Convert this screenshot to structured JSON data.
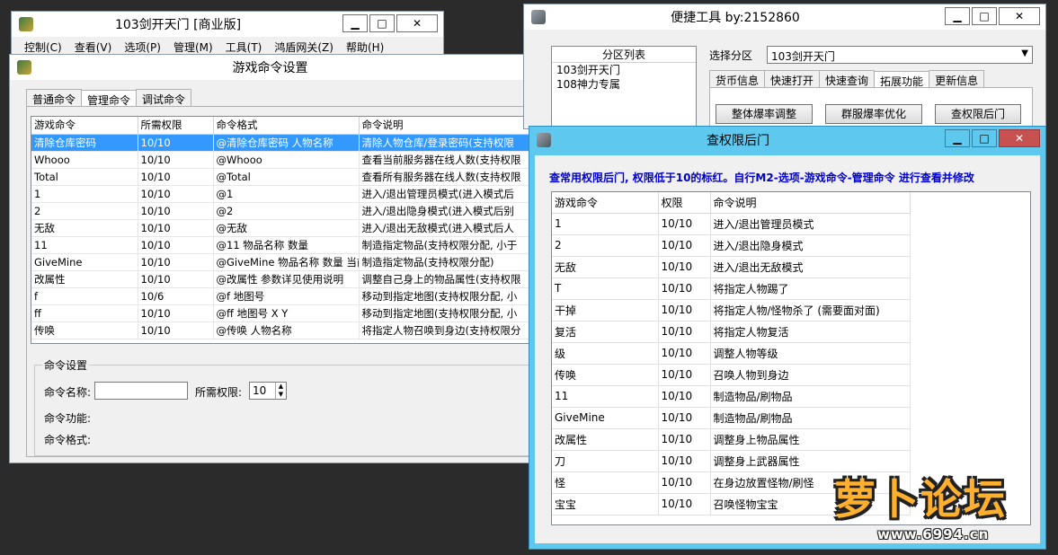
{
  "main_window": {
    "title": "103剑开天门 [商业版]",
    "menu": [
      "控制(C)",
      "查看(V)",
      "选项(P)",
      "管理(M)",
      "工具(T)",
      "鸿盾网关(Z)",
      "帮助(H)"
    ]
  },
  "cmd_window": {
    "title": "游戏命令设置",
    "tabs": [
      "普通命令",
      "管理命令",
      "调试命令"
    ],
    "columns": [
      "游戏命令",
      "所需权限",
      "命令格式",
      "命令说明"
    ],
    "rows": [
      [
        "清除仓库密码",
        "10/10",
        "@清除仓库密码 人物名称",
        "清除人物仓库/登录密码(支持权限"
      ],
      [
        "Whooo",
        "10/10",
        "@Whooo",
        "查看当前服务器在线人数(支持权限"
      ],
      [
        "Total",
        "10/10",
        "@Total",
        "查看所有服务器在线人数(支持权限"
      ],
      [
        "1",
        "10/10",
        "@1",
        "进入/退出管理员模式(进入模式后"
      ],
      [
        "2",
        "10/10",
        "@2",
        "进入/退出隐身模式(进入模式后别"
      ],
      [
        "无敌",
        "10/10",
        "@无敌",
        "进入/退出无敌模式(进入模式后人"
      ],
      [
        "11",
        "10/10",
        "@11 物品名称 数量",
        "制造指定物品(支持权限分配, 小于"
      ],
      [
        "GiveMine",
        "10/10",
        "@GiveMine 物品名称 数量 当前",
        "制造指定物品(支持权限分配)"
      ],
      [
        "改属性",
        "10/10",
        "@改属性 参数详见使用说明",
        "调整自己身上的物品属性(支持权限"
      ],
      [
        "f",
        "10/6",
        "@f 地图号",
        "移动到指定地图(支持权限分配, 小"
      ],
      [
        "ff",
        "10/10",
        "@ff 地图号 X Y",
        "移动到指定地图(支持权限分配, 小"
      ],
      [
        "传唤",
        "10/10",
        "@传唤 人物名称",
        "将指定人物召唤到身边(支持权限分"
      ]
    ],
    "settings": {
      "group_label": "命令设置",
      "name_label": "命令名称:",
      "name_value": "",
      "perm_label": "所需权限:",
      "perm_value": "10",
      "func_label": "命令功能:",
      "format_label": "命令格式:"
    }
  },
  "tool_window": {
    "title": "便捷工具 by:2152860",
    "list_header": "分区列表",
    "list_items": [
      "103剑开天门",
      "108神力专属"
    ],
    "select_label": "选择分区",
    "select_value": "103剑开天门",
    "tabs": [
      "货币信息",
      "快速打开",
      "快速查询",
      "拓展功能",
      "更新信息"
    ],
    "buttons": [
      "整体爆率调整",
      "群服爆率优化",
      "查权限后门"
    ]
  },
  "perm_window": {
    "title": "查权限后门",
    "note": "查常用权限后门, 权限低于10的标红。自行M2-选项-游戏命令-管理命令 进行查看并修改",
    "columns": [
      "游戏命令",
      "权限",
      "命令说明"
    ],
    "rows": [
      [
        "1",
        "10/10",
        "进入/退出管理员模式"
      ],
      [
        "2",
        "10/10",
        "进入/退出隐身模式"
      ],
      [
        "无敌",
        "10/10",
        "进入/退出无敌模式"
      ],
      [
        "T",
        "10/10",
        "将指定人物踢了"
      ],
      [
        "干掉",
        "10/10",
        "将指定人物/怪物杀了 (需要面对面)"
      ],
      [
        "复活",
        "10/10",
        "将指定人物复活"
      ],
      [
        "级",
        "10/10",
        "调整人物等级"
      ],
      [
        "传唤",
        "10/10",
        "召唤人物到身边"
      ],
      [
        "11",
        "10/10",
        "制造物品/刷物品"
      ],
      [
        "GiveMine",
        "10/10",
        "制造物品/刷物品"
      ],
      [
        "改属性",
        "10/10",
        "调整身上物品属性"
      ],
      [
        "刀",
        "10/10",
        "调整身上武器属性"
      ],
      [
        "怪",
        "10/10",
        "在身边放置怪物/刷怪"
      ],
      [
        "宝宝",
        "10/10",
        "召唤怪物宝宝"
      ]
    ]
  },
  "watermark": {
    "logo_text": "萝卜论坛",
    "url": "www.6994.cn"
  },
  "colors": {
    "selected_row": "#3399ff",
    "note_text": "#0000cc",
    "perm_title_bar": "#5ec8ee"
  }
}
